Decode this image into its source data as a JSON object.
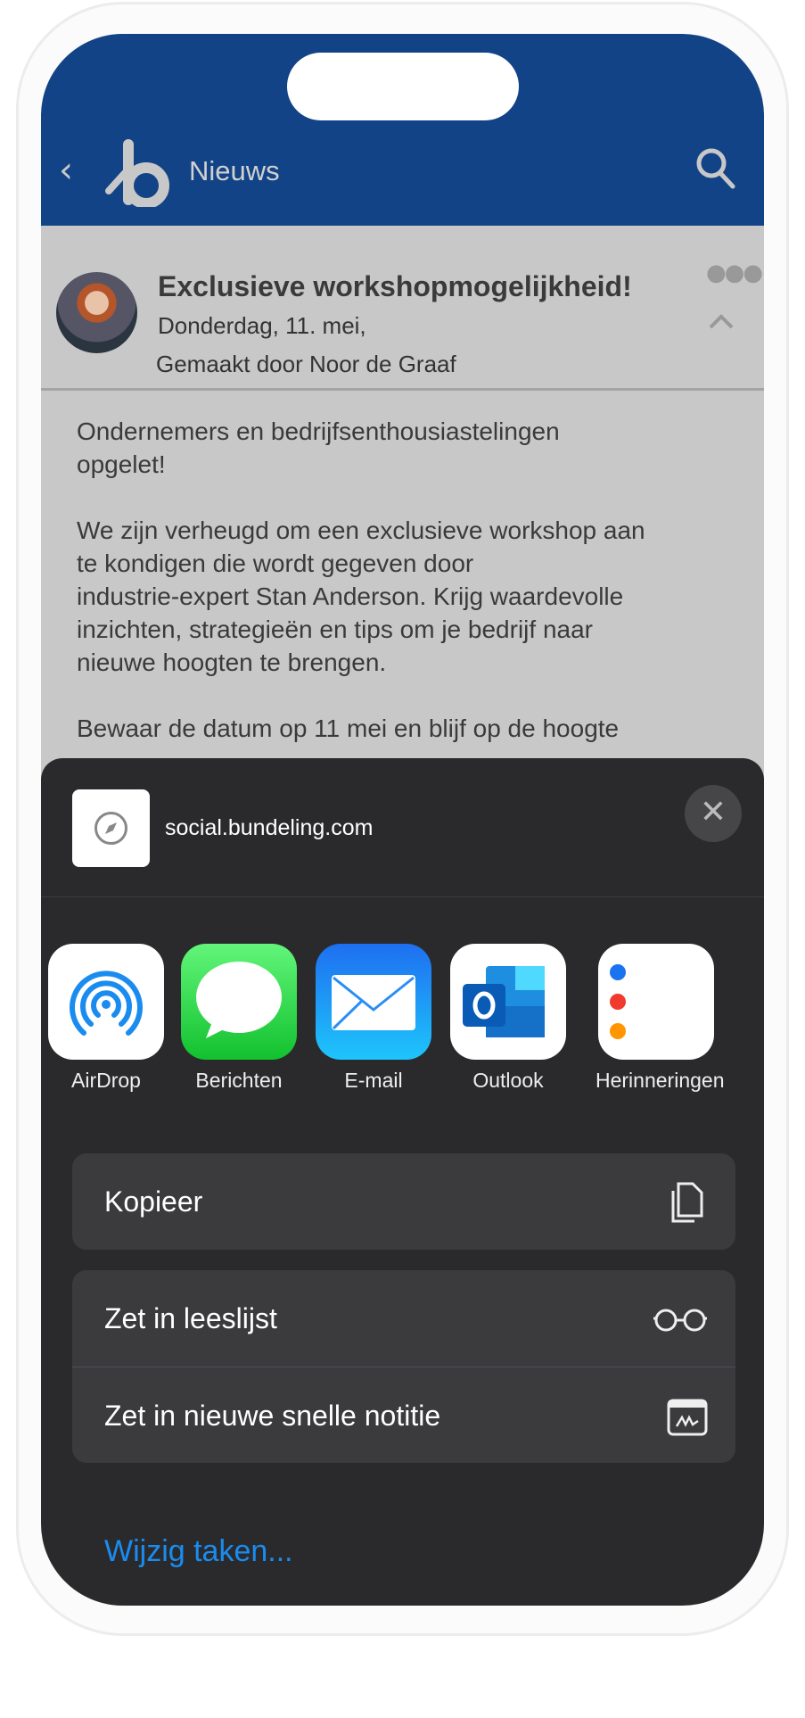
{
  "header": {
    "title": "Nieuws"
  },
  "post": {
    "title": "Exclusieve workshopmogelijkheid!",
    "date": "Donderdag, 11. mei,",
    "author": "Gemaakt door Noor de Graaf",
    "body": "Ondernemers en bedrijfsenthousiastelingen\nopgelet!\n\nWe zijn verheugd om een exclusieve workshop aan\nte kondigen die wordt gegeven door\nindustrie-expert Stan Anderson. Krijg waardevolle\ninzichten, strategieën en tips om je bedrijf naar\nnieuwe hoogten te brengen.\n\nBewaar de datum op 11 mei en blijf op de hoogte"
  },
  "share": {
    "url": "social.bundeling.com",
    "apps": [
      {
        "label": "AirDrop"
      },
      {
        "label": "Berichten"
      },
      {
        "label": "E-mail"
      },
      {
        "label": "Outlook"
      },
      {
        "label": "Herinneringen"
      }
    ],
    "actions": [
      {
        "label": "Kopieer",
        "icon": "copy-icon"
      },
      {
        "label": "Zet in leeslijst",
        "icon": "glasses-icon"
      },
      {
        "label": "Zet in nieuwe snelle notitie",
        "icon": "quick-note-icon"
      }
    ],
    "edit_label": "Wijzig taken..."
  },
  "colors": {
    "header": "#124387",
    "sheet": "#2a2a2c",
    "link": "#1a8cf0"
  }
}
